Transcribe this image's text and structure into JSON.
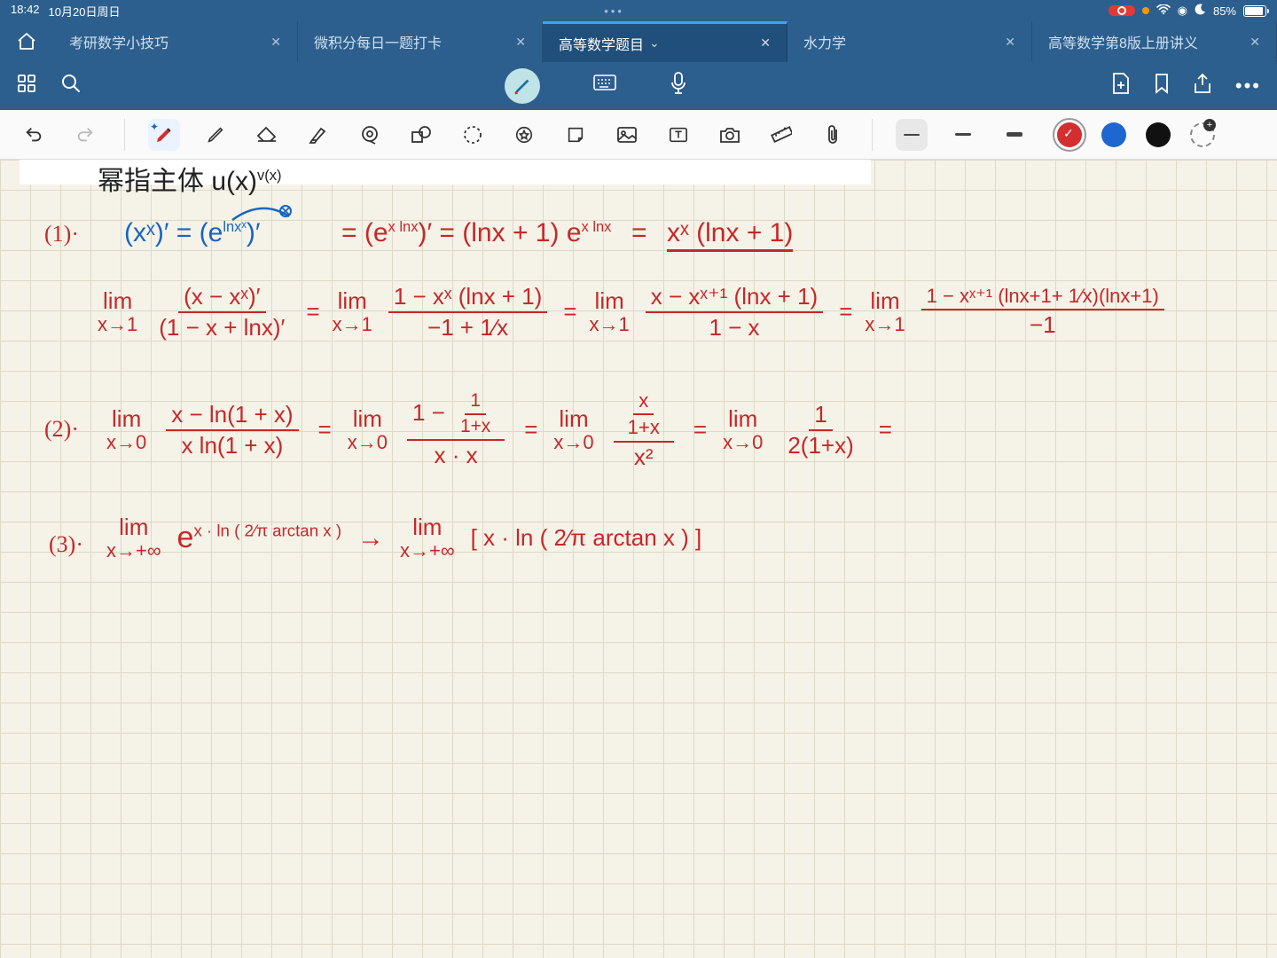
{
  "status": {
    "time": "18:42",
    "date": "10月20日周日",
    "battery_pct": "85%"
  },
  "tabs": {
    "items": [
      {
        "title": "考研数学小技巧"
      },
      {
        "title": "微积分每日一题打卡"
      },
      {
        "title": "高等数学题目",
        "active": true,
        "chevron": "⌄"
      },
      {
        "title": "水力学"
      },
      {
        "title": "高等数学第8版上册讲义"
      }
    ]
  },
  "toolbar": {
    "colors": {
      "red": "#d32f2f",
      "blue": "#1e66d0",
      "black": "#111"
    }
  },
  "handwriting": {
    "heading_black": "幂指主体   u(x)",
    "heading_exp": "v(x)",
    "l1_label": "(1)·",
    "l1_blue": "(xˣ)′ = (e",
    "l1_blue_exp": "lnxˣ",
    "l1_blue_after": ")′",
    "l1_red_a": "= (e",
    "l1_red_a_exp": "x lnx",
    "l1_red_a_after": ")′ = (lnx + 1) e",
    "l1_red_a_exp2": "x lnx",
    "l1_red_eq": "=",
    "l1_red_b": "xˣ (lnx + 1)",
    "l2_lim": "lim",
    "l2_lim_sub": "x→1",
    "l2_f1_num": "(x − xˣ)′",
    "l2_f1_den": "(1 − x + lnx)′",
    "l2_eq": "=",
    "l2_f2_num": "1 − xˣ (lnx + 1)",
    "l2_f2_den": "−1 + 1⁄x",
    "l2_f3_num": "x − xˣ⁺¹ (lnx + 1)",
    "l2_f3_den": "1 − x",
    "l2_f4_num": "1 − xˣ⁺¹ (lnx+1+ 1⁄x)(lnx+1)",
    "l2_f4_den": "−1",
    "l3_label": "(2)·",
    "l3_f1_num": "x − ln(1 + x)",
    "l3_f1_den": "x ln(1 + x)",
    "l3_lim_sub": "x→0",
    "l3_f2_top_num": "1",
    "l3_f2_top_den": "1+x",
    "l3_f2_num_prefix": "1 −",
    "l3_f2_den": "x · x",
    "l3_f3_top_num": "x",
    "l3_f3_top_den": "1+x",
    "l3_f3_den": "x²",
    "l3_f4_num": "1",
    "l3_f4_den": "2(1+x)",
    "l4_label": "(3)·",
    "l4_lim_sub": "x→+∞",
    "l4_e": "e",
    "l4_e_exp": "x · ln ( 2⁄π arctan x )",
    "l4_arrow": "→",
    "l4_body": "[ x · ln ( 2⁄π arctan x ) ]"
  }
}
